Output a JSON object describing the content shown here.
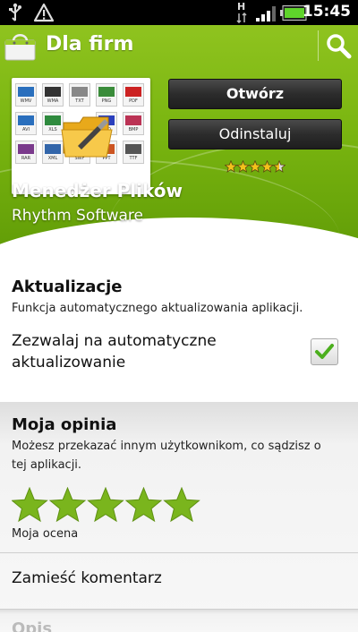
{
  "status_bar": {
    "time": "15:45",
    "network_letter": "H",
    "icons": [
      "usb-icon",
      "warning-icon",
      "data-arrows-icon",
      "signal-icon",
      "battery-icon"
    ]
  },
  "header": {
    "title": "Dla firm",
    "icons": [
      "market-bag-icon",
      "search-icon"
    ]
  },
  "app": {
    "name": "Menedżer Plików",
    "developer": "Rhythm Software",
    "rating": 4.5,
    "rating_max": 5,
    "icon_tiles": [
      {
        "label": "WMV",
        "color": "#2a6fbd"
      },
      {
        "label": "WMA",
        "color": "#333333"
      },
      {
        "label": "TXT",
        "color": "#888888"
      },
      {
        "label": "PNG",
        "color": "#3a8c3a"
      },
      {
        "label": "PDF",
        "color": "#cc2222"
      },
      {
        "label": "AVI",
        "color": "#2a6fbd"
      },
      {
        "label": "XLS",
        "color": "#2f8a3e"
      },
      {
        "label": "PSD",
        "color": "#2a3fbd"
      },
      {
        "label": "BMP",
        "color": "#bb3355"
      },
      {
        "label": "RAR",
        "color": "#7a3a8c"
      },
      {
        "label": "XML",
        "color": "#3366aa"
      },
      {
        "label": "SWF",
        "color": "#cc2222"
      },
      {
        "label": "PPT",
        "color": "#cc5522"
      },
      {
        "label": "TTF",
        "color": "#555555"
      }
    ]
  },
  "buttons": {
    "open_label": "Otwórz",
    "uninstall_label": "Odinstaluj"
  },
  "updates": {
    "heading": "Aktualizacje",
    "description": "Funkcja automatycznego aktualizowania aplikacji.",
    "toggle_label_line1": "Zezwalaj na automatyczne",
    "toggle_label_line2": "aktualizowanie",
    "toggle_checked": true
  },
  "review": {
    "heading": "Moja opinia",
    "description_line1": "Możesz przekazać innym użytkownikom, co sądzisz o",
    "description_line2": "tej aplikacji.",
    "my_rating": 5,
    "rating_max": 5,
    "rating_label": "Moja ocena",
    "comment_label": "Zamieść komentarz"
  },
  "next_section": {
    "heading": "Opis"
  },
  "colors": {
    "accent_green": "#79b510",
    "star_green": "#7ab51d",
    "button_dark": "#2c2c2c",
    "check_green": "#4caf1e"
  }
}
